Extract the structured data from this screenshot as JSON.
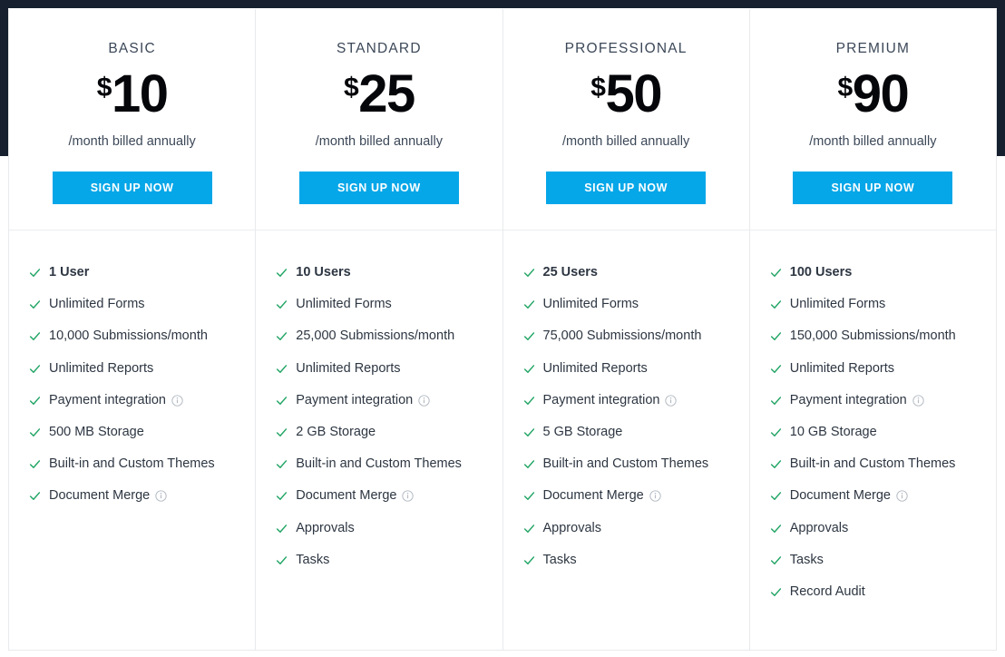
{
  "theme": {
    "page_background": "#16202e",
    "card_background": "#ffffff",
    "divider": "#e8eaec",
    "accent_button": "#06a7e8",
    "check_green": "#22a565",
    "info_gray": "#b5bcc4",
    "text_dark": "#2d3642",
    "plan_name_color": "#3c4858",
    "price_color": "#05060a"
  },
  "icons": {
    "check": "check-icon",
    "info": "info-icon"
  },
  "plans": [
    {
      "name": "BASIC",
      "currency": "$",
      "amount": "10",
      "billing": "/month billed annually",
      "cta": "SIGN UP NOW",
      "features": [
        {
          "label": "1 User",
          "emphasis": true,
          "info": false
        },
        {
          "label": "Unlimited Forms",
          "emphasis": false,
          "info": false
        },
        {
          "label": "10,000 Submissions/month",
          "emphasis": false,
          "info": false
        },
        {
          "label": "Unlimited Reports",
          "emphasis": false,
          "info": false
        },
        {
          "label": "Payment integration",
          "emphasis": false,
          "info": true
        },
        {
          "label": "500 MB Storage",
          "emphasis": false,
          "info": false
        },
        {
          "label": "Built-in and Custom Themes",
          "emphasis": false,
          "info": false
        },
        {
          "label": "Document Merge",
          "emphasis": false,
          "info": true
        }
      ]
    },
    {
      "name": "STANDARD",
      "currency": "$",
      "amount": "25",
      "billing": "/month billed annually",
      "cta": "SIGN UP NOW",
      "features": [
        {
          "label": "10 Users",
          "emphasis": true,
          "info": false
        },
        {
          "label": "Unlimited Forms",
          "emphasis": false,
          "info": false
        },
        {
          "label": "25,000 Submissions/month",
          "emphasis": false,
          "info": false
        },
        {
          "label": "Unlimited Reports",
          "emphasis": false,
          "info": false
        },
        {
          "label": "Payment integration",
          "emphasis": false,
          "info": true
        },
        {
          "label": "2 GB Storage",
          "emphasis": false,
          "info": false
        },
        {
          "label": "Built-in and Custom Themes",
          "emphasis": false,
          "info": false
        },
        {
          "label": "Document Merge",
          "emphasis": false,
          "info": true
        },
        {
          "label": "Approvals",
          "emphasis": false,
          "info": false
        },
        {
          "label": "Tasks",
          "emphasis": false,
          "info": false
        }
      ]
    },
    {
      "name": "PROFESSIONAL",
      "currency": "$",
      "amount": "50",
      "billing": "/month billed annually",
      "cta": "SIGN UP NOW",
      "features": [
        {
          "label": "25 Users",
          "emphasis": true,
          "info": false
        },
        {
          "label": "Unlimited Forms",
          "emphasis": false,
          "info": false
        },
        {
          "label": "75,000 Submissions/month",
          "emphasis": false,
          "info": false
        },
        {
          "label": "Unlimited Reports",
          "emphasis": false,
          "info": false
        },
        {
          "label": "Payment integration",
          "emphasis": false,
          "info": true
        },
        {
          "label": "5 GB Storage",
          "emphasis": false,
          "info": false
        },
        {
          "label": "Built-in and Custom Themes",
          "emphasis": false,
          "info": false
        },
        {
          "label": "Document Merge",
          "emphasis": false,
          "info": true
        },
        {
          "label": "Approvals",
          "emphasis": false,
          "info": false
        },
        {
          "label": "Tasks",
          "emphasis": false,
          "info": false
        }
      ]
    },
    {
      "name": "PREMIUM",
      "currency": "$",
      "amount": "90",
      "billing": "/month billed annually",
      "cta": "SIGN UP NOW",
      "features": [
        {
          "label": "100 Users",
          "emphasis": true,
          "info": false
        },
        {
          "label": "Unlimited Forms",
          "emphasis": false,
          "info": false
        },
        {
          "label": "150,000 Submissions/month",
          "emphasis": false,
          "info": false
        },
        {
          "label": "Unlimited Reports",
          "emphasis": false,
          "info": false
        },
        {
          "label": "Payment integration",
          "emphasis": false,
          "info": true
        },
        {
          "label": "10 GB Storage",
          "emphasis": false,
          "info": false
        },
        {
          "label": "Built-in and Custom Themes",
          "emphasis": false,
          "info": false
        },
        {
          "label": "Document Merge",
          "emphasis": false,
          "info": true
        },
        {
          "label": "Approvals",
          "emphasis": false,
          "info": false
        },
        {
          "label": "Tasks",
          "emphasis": false,
          "info": false
        },
        {
          "label": "Record Audit",
          "emphasis": false,
          "info": false
        }
      ]
    }
  ]
}
